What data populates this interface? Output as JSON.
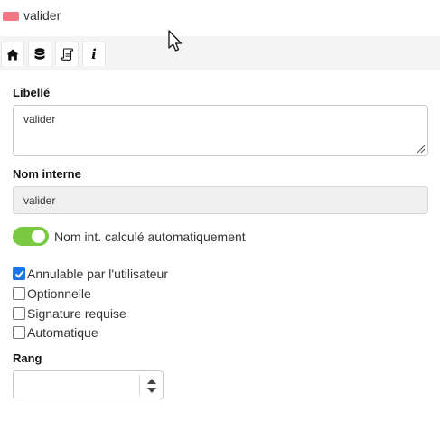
{
  "header": {
    "color": "#f07884",
    "title": "valider"
  },
  "toolbar": {
    "tabs": [
      {
        "icon": "home-icon"
      },
      {
        "icon": "database-icon"
      },
      {
        "icon": "scroll-icon"
      },
      {
        "icon": "info-icon",
        "glyph": "i"
      }
    ]
  },
  "form": {
    "libelle": {
      "label": "Libellé",
      "value": "valider"
    },
    "nom_interne": {
      "label": "Nom interne",
      "value": "valider"
    },
    "toggle": {
      "on": true,
      "label": "Nom int. calculé automatiquement",
      "color": "#7ac943"
    },
    "checkboxes": [
      {
        "label": "Annulable par l'utilisateur",
        "checked": true
      },
      {
        "label": "Optionnelle",
        "checked": false
      },
      {
        "label": "Signature requise",
        "checked": false
      },
      {
        "label": "Automatique",
        "checked": false
      }
    ],
    "rang": {
      "label": "Rang",
      "value": ""
    }
  }
}
